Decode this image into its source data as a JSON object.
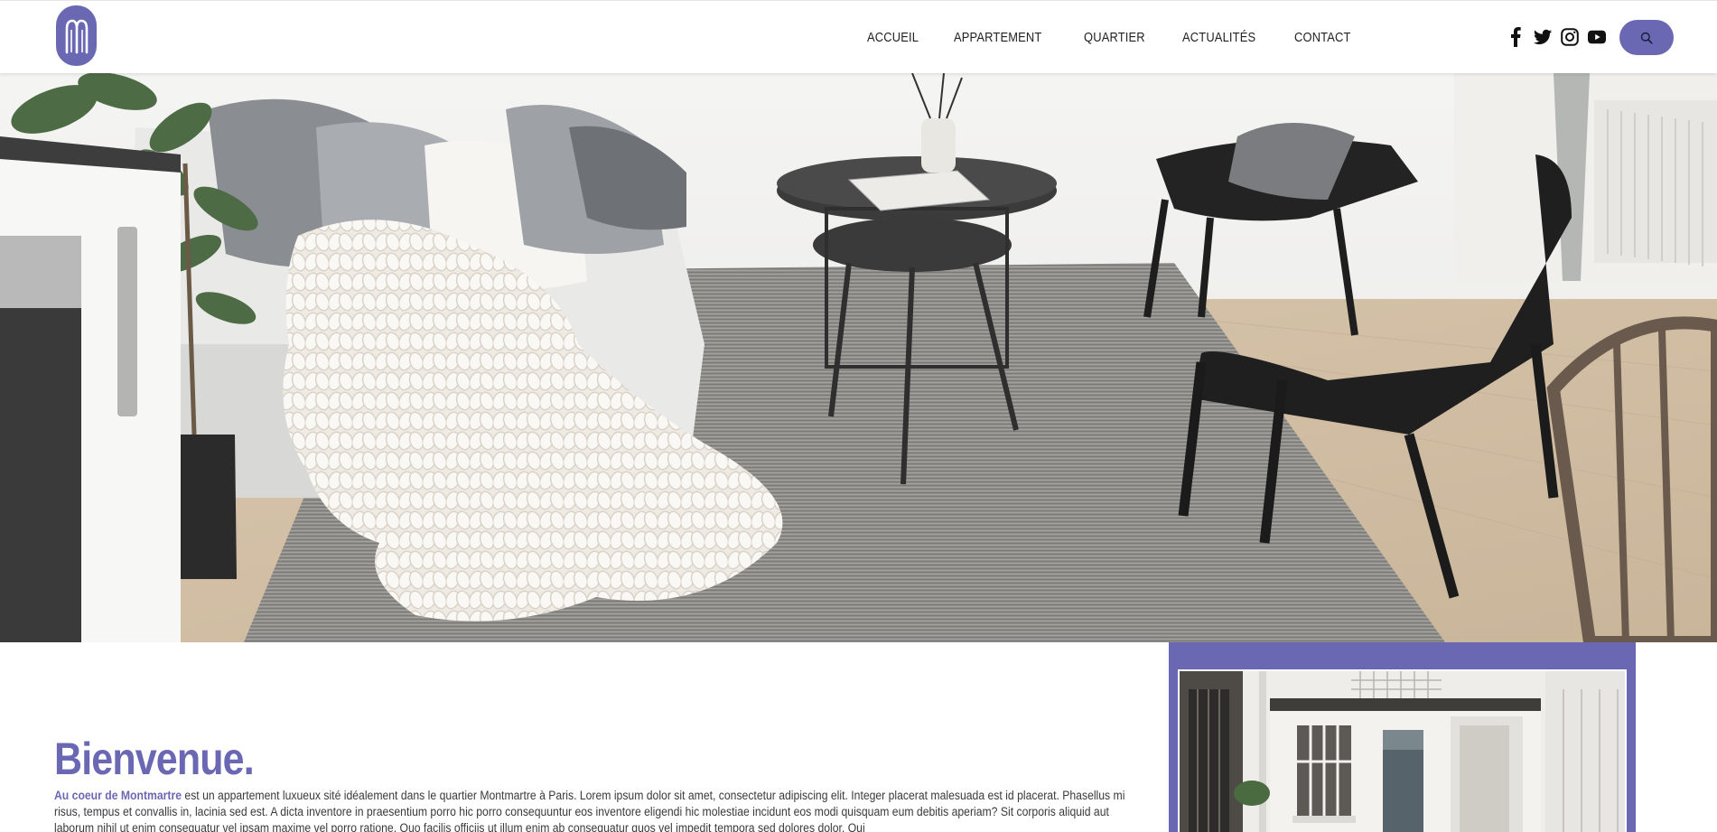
{
  "header": {
    "logo_alt": "M",
    "nav": [
      {
        "label": "ACCUEIL"
      },
      {
        "label": "APPARTEMENT"
      },
      {
        "label": "QUARTIER"
      },
      {
        "label": "ACTUALITÉS"
      },
      {
        "label": "CONTACT"
      }
    ],
    "social": [
      "facebook-icon",
      "twitter-icon",
      "instagram-icon",
      "youtube-icon"
    ],
    "search_icon": "search-icon"
  },
  "colors": {
    "accent": "#6b68b3",
    "text": "#3a3a3a"
  },
  "main": {
    "title": "Bienvenue.",
    "intro_highlight": "Au coeur de Montmartre",
    "intro_text": " est un appartement luxueux sité idéalement dans le quartier Montmartre à Paris. Lorem ipsum dolor sit amet, consectetur adipiscing elit. Integer placerat malesuada est id placerat. Phasellus mi risus, tempus et convallis in, lacinia sed est. A dicta inventore in praesentium porro hic porro consequuntur eos inventore eligendi hic molestiae incidunt eos modi quisquam eum debitis aperiam? Sit corporis aliquid aut laborum nihil ut enim consequatur vel ipsam maxime vel porro ratione. Quo facilis officiis ut illum enim ab consequatur quos vel impedit tempora sed dolores dolor. Qui"
  }
}
